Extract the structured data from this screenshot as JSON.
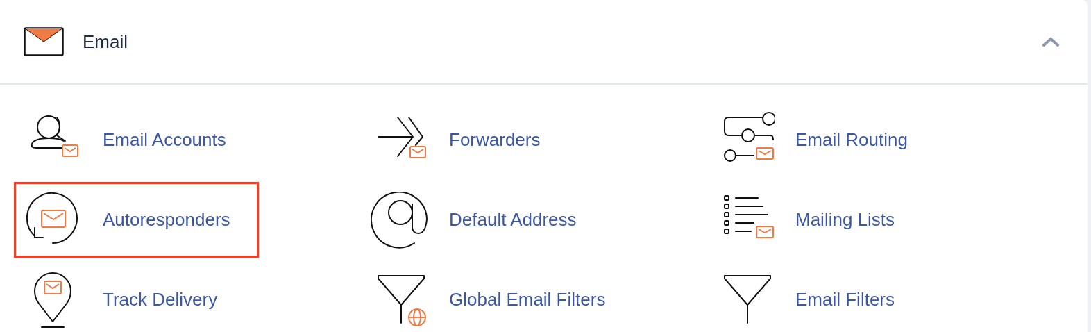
{
  "section": {
    "title": "Email",
    "expanded": true
  },
  "items": [
    {
      "kind": "accounts",
      "label": "Email Accounts",
      "highlighted": false
    },
    {
      "kind": "forwarders",
      "label": "Forwarders",
      "highlighted": false
    },
    {
      "kind": "routing",
      "label": "Email Routing",
      "highlighted": false
    },
    {
      "kind": "autoresponders",
      "label": "Autoresponders",
      "highlighted": true
    },
    {
      "kind": "default-address",
      "label": "Default Address",
      "highlighted": false
    },
    {
      "kind": "mailing-lists",
      "label": "Mailing Lists",
      "highlighted": false
    },
    {
      "kind": "track-delivery",
      "label": "Track Delivery",
      "highlighted": false
    },
    {
      "kind": "global-filters",
      "label": "Global Email Filters",
      "highlighted": false
    },
    {
      "kind": "filters",
      "label": "Email Filters",
      "highlighted": false
    }
  ]
}
